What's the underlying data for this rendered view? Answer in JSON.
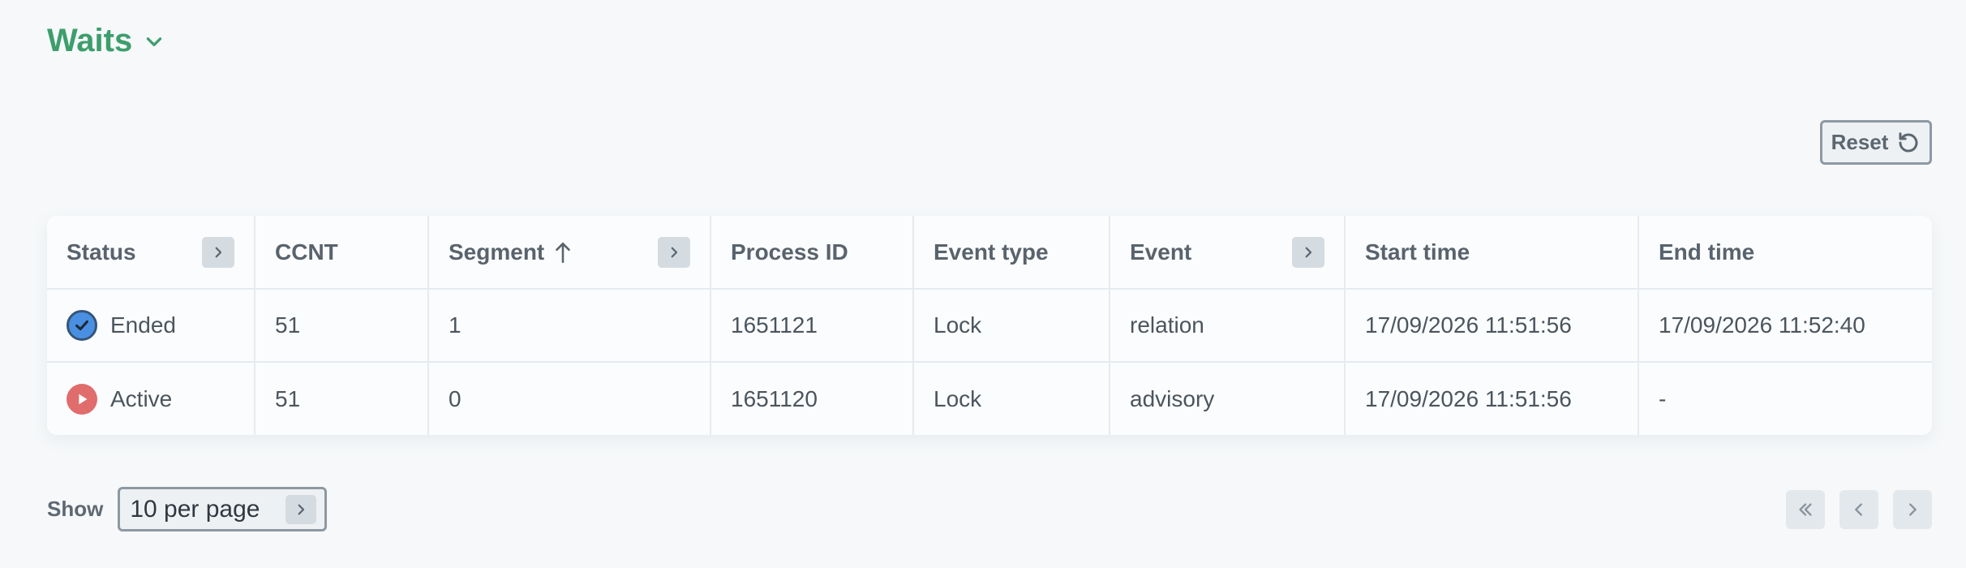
{
  "header": {
    "title": "Waits"
  },
  "toolbar": {
    "reset_label": "Reset"
  },
  "table": {
    "columns": [
      {
        "key": "status",
        "label": "Status",
        "has_toggle": true
      },
      {
        "key": "ccnt",
        "label": "CCNT",
        "has_toggle": false
      },
      {
        "key": "segment",
        "label": "Segment",
        "has_toggle": true,
        "sort": "asc"
      },
      {
        "key": "process_id",
        "label": "Process ID",
        "has_toggle": false
      },
      {
        "key": "event_type",
        "label": "Event type",
        "has_toggle": false
      },
      {
        "key": "event",
        "label": "Event",
        "has_toggle": true
      },
      {
        "key": "start_time",
        "label": "Start time",
        "has_toggle": false
      },
      {
        "key": "end_time",
        "label": "End time",
        "has_toggle": false
      }
    ],
    "rows": [
      {
        "status": "Ended",
        "status_icon": "check-circle-icon",
        "ccnt": "51",
        "segment": "1",
        "process_id": "1651121",
        "event_type": "Lock",
        "event": "relation",
        "start_time": "17/09/2026 11:51:56",
        "end_time": "17/09/2026 11:52:40"
      },
      {
        "status": "Active",
        "status_icon": "play-circle-icon",
        "ccnt": "51",
        "segment": "0",
        "process_id": "1651120",
        "event_type": "Lock",
        "event": "advisory",
        "start_time": "17/09/2026 11:51:56",
        "end_time": "-"
      }
    ]
  },
  "footer": {
    "show_label": "Show",
    "per_page_value": "10 per page"
  },
  "colors": {
    "accent": "#3d9e6c",
    "ended": "#4a90e2",
    "active": "#e06c6c"
  }
}
